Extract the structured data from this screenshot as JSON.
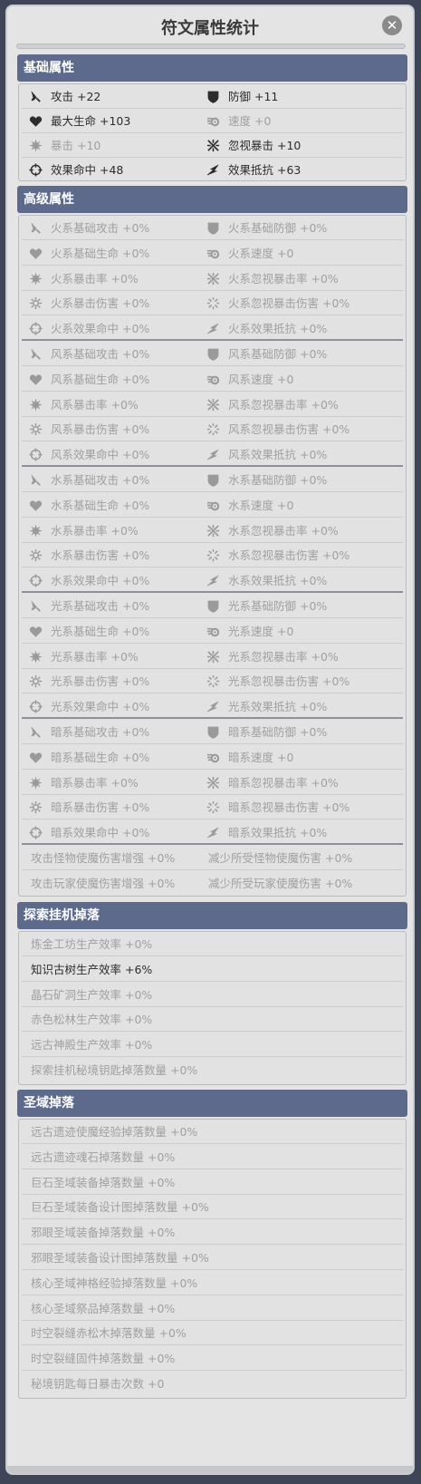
{
  "window": {
    "title": "符文属性统计",
    "close_glyph": "✕"
  },
  "basic": {
    "header": "基础属性",
    "rows": [
      [
        {
          "icon": "sword-icon",
          "label": "攻击 +22",
          "active": true
        },
        {
          "icon": "shield-icon",
          "label": "防御 +11",
          "active": true
        }
      ],
      [
        {
          "icon": "heart-icon",
          "label": "最大生命 +103",
          "active": true
        },
        {
          "icon": "speed-icon",
          "label": "速度 +0",
          "active": false
        }
      ],
      [
        {
          "icon": "crit-icon",
          "label": "暴击 +10",
          "active": false
        },
        {
          "icon": "ignore-crit-icon",
          "label": "忽视暴击 +10",
          "active": true
        }
      ],
      [
        {
          "icon": "target-icon",
          "label": "效果命中 +48",
          "active": true
        },
        {
          "icon": "resist-icon",
          "label": "效果抵抗 +63",
          "active": true
        }
      ]
    ]
  },
  "advanced": {
    "header": "高级属性",
    "rows": [
      [
        {
          "icon": "sword-icon",
          "label": "火系基础攻击 +0%"
        },
        {
          "icon": "shield-icon",
          "label": "火系基础防御 +0%"
        }
      ],
      [
        {
          "icon": "heart-icon",
          "label": "火系基础生命 +0%"
        },
        {
          "icon": "speed-icon",
          "label": "火系速度 +0"
        }
      ],
      [
        {
          "icon": "crit-icon",
          "label": "火系暴击率 +0%"
        },
        {
          "icon": "ignore-crit-icon",
          "label": "火系忽视暴击率 +0%"
        }
      ],
      [
        {
          "icon": "crit-damage-icon",
          "label": "火系暴击伤害 +0%"
        },
        {
          "icon": "ignore-crit-damage-icon",
          "label": "火系忽视暴击伤害 +0%"
        }
      ],
      [
        {
          "icon": "target-icon",
          "label": "火系效果命中 +0%"
        },
        {
          "icon": "resist-icon",
          "label": "火系效果抵抗 +0%"
        }
      ],
      [
        {
          "icon": "sword-icon",
          "label": "风系基础攻击 +0%"
        },
        {
          "icon": "shield-icon",
          "label": "风系基础防御 +0%"
        }
      ],
      [
        {
          "icon": "heart-icon",
          "label": "风系基础生命 +0%"
        },
        {
          "icon": "speed-icon",
          "label": "风系速度 +0"
        }
      ],
      [
        {
          "icon": "crit-icon",
          "label": "风系暴击率 +0%"
        },
        {
          "icon": "ignore-crit-icon",
          "label": "风系忽视暴击率 +0%"
        }
      ],
      [
        {
          "icon": "crit-damage-icon",
          "label": "风系暴击伤害 +0%"
        },
        {
          "icon": "ignore-crit-damage-icon",
          "label": "风系忽视暴击伤害 +0%"
        }
      ],
      [
        {
          "icon": "target-icon",
          "label": "风系效果命中 +0%"
        },
        {
          "icon": "resist-icon",
          "label": "风系效果抵抗 +0%"
        }
      ],
      [
        {
          "icon": "sword-icon",
          "label": "水系基础攻击 +0%"
        },
        {
          "icon": "shield-icon",
          "label": "水系基础防御 +0%"
        }
      ],
      [
        {
          "icon": "heart-icon",
          "label": "水系基础生命 +0%"
        },
        {
          "icon": "speed-icon",
          "label": "水系速度 +0"
        }
      ],
      [
        {
          "icon": "crit-icon",
          "label": "水系暴击率 +0%"
        },
        {
          "icon": "ignore-crit-icon",
          "label": "水系忽视暴击率 +0%"
        }
      ],
      [
        {
          "icon": "crit-damage-icon",
          "label": "水系暴击伤害 +0%"
        },
        {
          "icon": "ignore-crit-damage-icon",
          "label": "水系忽视暴击伤害 +0%"
        }
      ],
      [
        {
          "icon": "target-icon",
          "label": "水系效果命中 +0%"
        },
        {
          "icon": "resist-icon",
          "label": "水系效果抵抗 +0%"
        }
      ],
      [
        {
          "icon": "sword-icon",
          "label": "光系基础攻击 +0%"
        },
        {
          "icon": "shield-icon",
          "label": "光系基础防御 +0%"
        }
      ],
      [
        {
          "icon": "heart-icon",
          "label": "光系基础生命 +0%"
        },
        {
          "icon": "speed-icon",
          "label": "光系速度 +0"
        }
      ],
      [
        {
          "icon": "crit-icon",
          "label": "光系暴击率 +0%"
        },
        {
          "icon": "ignore-crit-icon",
          "label": "光系忽视暴击率 +0%"
        }
      ],
      [
        {
          "icon": "crit-damage-icon",
          "label": "光系暴击伤害 +0%"
        },
        {
          "icon": "ignore-crit-damage-icon",
          "label": "光系忽视暴击伤害 +0%"
        }
      ],
      [
        {
          "icon": "target-icon",
          "label": "光系效果命中 +0%"
        },
        {
          "icon": "resist-icon",
          "label": "光系效果抵抗 +0%"
        }
      ],
      [
        {
          "icon": "sword-icon",
          "label": "暗系基础攻击 +0%"
        },
        {
          "icon": "shield-icon",
          "label": "暗系基础防御 +0%"
        }
      ],
      [
        {
          "icon": "heart-icon",
          "label": "暗系基础生命 +0%"
        },
        {
          "icon": "speed-icon",
          "label": "暗系速度 +0"
        }
      ],
      [
        {
          "icon": "crit-icon",
          "label": "暗系暴击率 +0%"
        },
        {
          "icon": "ignore-crit-icon",
          "label": "暗系忽视暴击率 +0%"
        }
      ],
      [
        {
          "icon": "crit-damage-icon",
          "label": "暗系暴击伤害 +0%"
        },
        {
          "icon": "ignore-crit-damage-icon",
          "label": "暗系忽视暴击伤害 +0%"
        }
      ],
      [
        {
          "icon": "target-icon",
          "label": "暗系效果命中 +0%"
        },
        {
          "icon": "resist-icon",
          "label": "暗系效果抵抗 +0%"
        }
      ],
      [
        {
          "icon": "",
          "label": "攻击怪物使魔伤害增强 +0%"
        },
        {
          "icon": "",
          "label": "减少所受怪物使魔伤害 +0%"
        }
      ],
      [
        {
          "icon": "",
          "label": "攻击玩家使魔伤害增强 +0%"
        },
        {
          "icon": "",
          "label": "减少所受玩家使魔伤害 +0%"
        }
      ]
    ]
  },
  "explore": {
    "header": "探索挂机掉落",
    "rows": [
      {
        "label": "炼金工坊生产效率 +0%",
        "active": false
      },
      {
        "label": "知识古树生产效率 +6%",
        "active": true
      },
      {
        "label": "晶石矿洞生产效率 +0%",
        "active": false
      },
      {
        "label": "赤色松林生产效率 +0%",
        "active": false
      },
      {
        "label": "远古神殿生产效率 +0%",
        "active": false
      },
      {
        "label": "探索挂机秘境钥匙掉落数量 +0%",
        "active": false
      }
    ]
  },
  "holy": {
    "header": "圣域掉落",
    "rows": [
      {
        "label": "远古遗迹使魔经验掉落数量 +0%"
      },
      {
        "label": "远古遗迹魂石掉落数量 +0%"
      },
      {
        "label": "巨石圣域装备掉落数量 +0%"
      },
      {
        "label": "巨石圣域装备设计图掉落数量 +0%"
      },
      {
        "label": "邪眼圣域装备掉落数量 +0%"
      },
      {
        "label": "邪眼圣域装备设计图掉落数量 +0%"
      },
      {
        "label": "核心圣域神格经验掉落数量 +0%"
      },
      {
        "label": "核心圣域祭品掉落数量 +0%"
      },
      {
        "label": "时空裂缝赤松木掉落数量 +0%"
      },
      {
        "label": "时空裂缝固件掉落数量 +0%"
      },
      {
        "label": "秘境钥匙每日暴击次数 +0"
      }
    ]
  }
}
